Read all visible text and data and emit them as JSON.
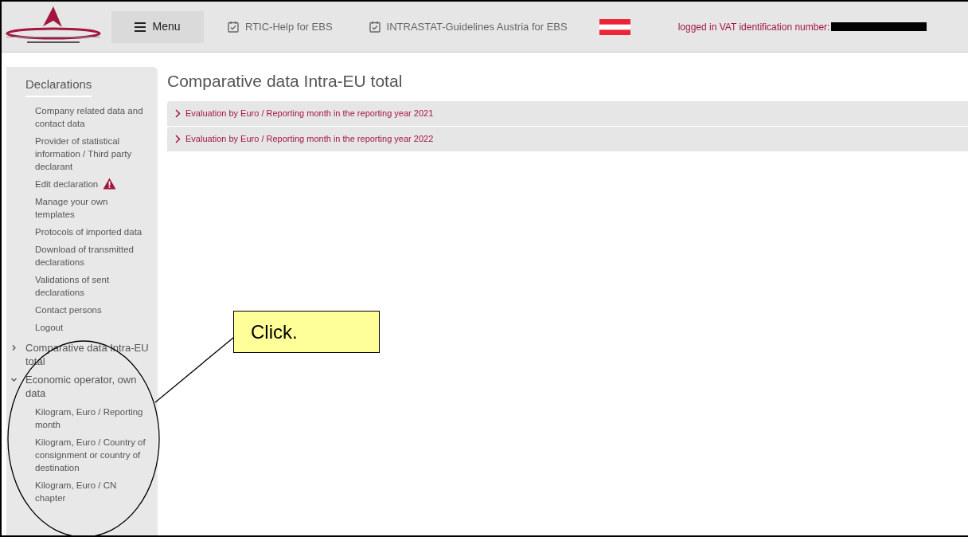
{
  "header": {
    "menu_button": "Menu",
    "links": [
      {
        "label": "RTIC-Help for EBS"
      },
      {
        "label": "INTRASTAT-Guidelines Austria for EBS"
      }
    ],
    "login_label": "logged in VAT identification number:"
  },
  "sidebar": {
    "sections": [
      {
        "label": "Declarations",
        "kind": "heading",
        "children": [
          {
            "label": "Company related data and contact data"
          },
          {
            "label": "Provider of statistical information / Third party declarant"
          },
          {
            "label": "Edit declaration",
            "warning": true
          },
          {
            "label": "Manage your own templates"
          },
          {
            "label": "Protocols of imported data"
          },
          {
            "label": "Download of transmitted declarations"
          },
          {
            "label": "Validations of sent declarations"
          },
          {
            "label": "Contact persons"
          },
          {
            "label": "Logout"
          }
        ]
      },
      {
        "label": "Comparative data Intra-EU total",
        "kind": "toggle",
        "expanded": false
      },
      {
        "label": "Economic operator, own data",
        "kind": "toggle",
        "expanded": true,
        "children": [
          {
            "label": "Kilogram, Euro / Reporting month"
          },
          {
            "label": "Kilogram, Euro / Country of consignment or country of destination"
          },
          {
            "label": "Kilogram, Euro / CN chapter"
          }
        ]
      }
    ]
  },
  "page_title": "Comparative data Intra-EU total",
  "accordion": [
    {
      "label": "Evaluation by Euro / Reporting month in the reporting year 2021",
      "expanded": false
    },
    {
      "label": "Evaluation by Euro / Reporting month in the reporting year 2022",
      "expanded": false
    }
  ],
  "annotation": {
    "text": "Click."
  }
}
